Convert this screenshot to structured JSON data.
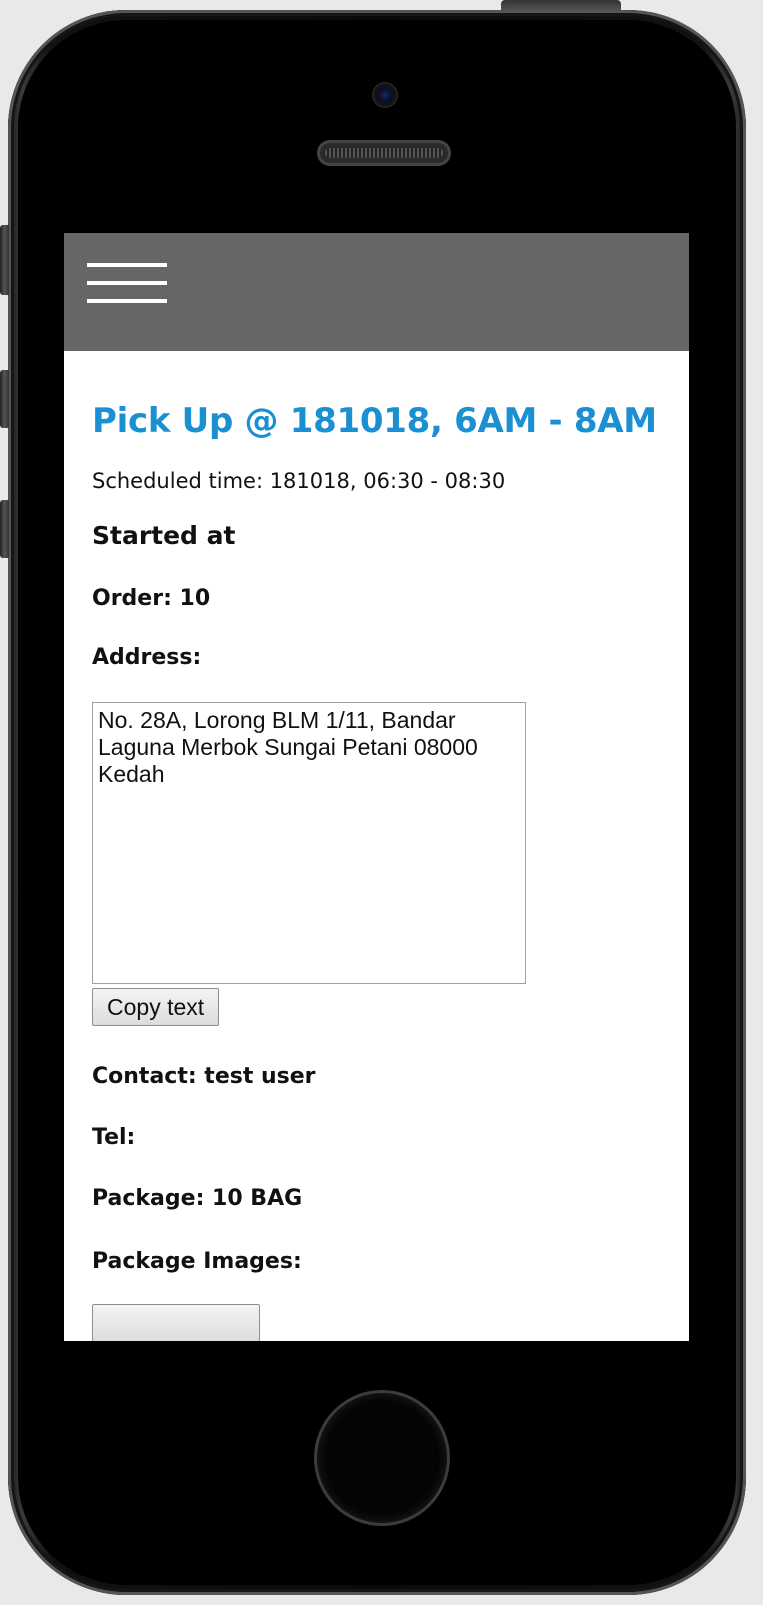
{
  "page": {
    "title": "Pick Up @ 181018, 6AM - 8AM",
    "scheduled_time": "Scheduled time: 181018, 06:30 - 08:30",
    "started_at": "Started at",
    "order": "Order: 10",
    "address_label": "Address:",
    "address_value": "No. 28A, Lorong BLM 1/11, Bandar Laguna Merbok Sungai Petani 08000 Kedah",
    "copy_button": "Copy text",
    "contact": "Contact: test user",
    "tel": "Tel:",
    "package": "Package: 10 BAG",
    "package_images": "Package Images:"
  },
  "navbar": {
    "background": "#666666",
    "menu_icon": "hamburger-menu-icon"
  },
  "colors": {
    "title": "#1a8fd1"
  }
}
